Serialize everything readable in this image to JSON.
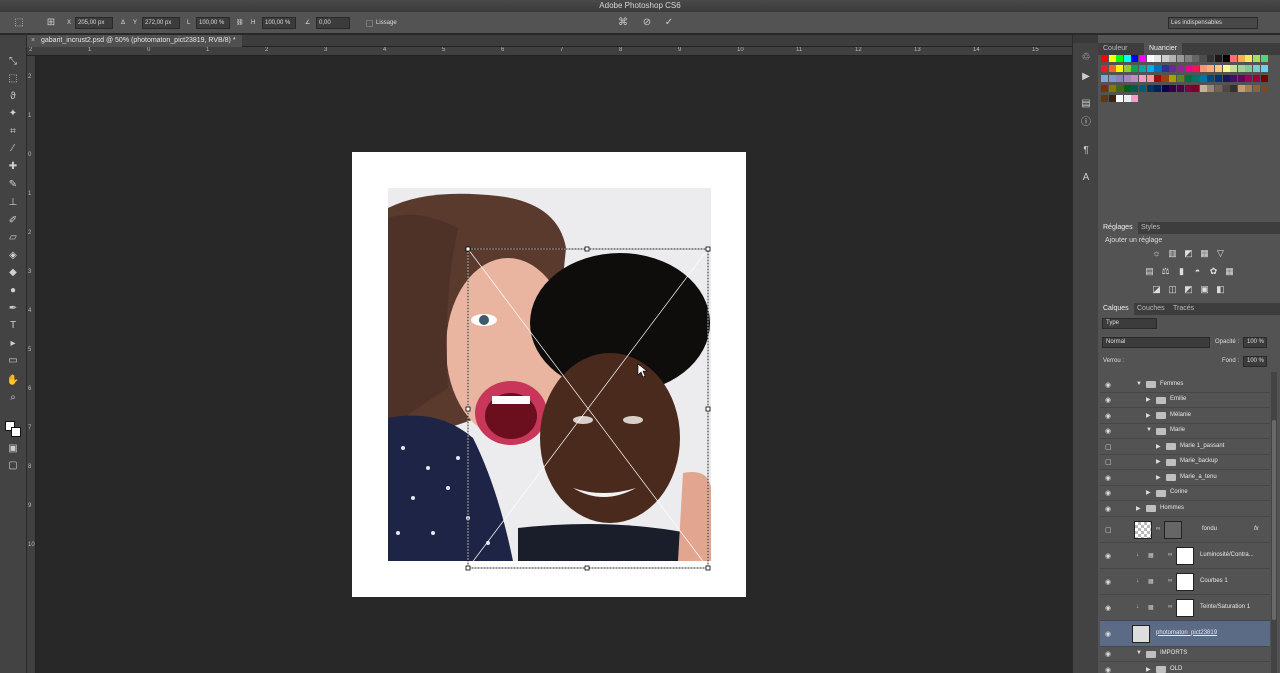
{
  "app": {
    "title": "Adobe Photoshop CS6"
  },
  "options": {
    "x_label": "X",
    "x_value": "205,00 px",
    "y_label": "Y",
    "y_value": "272,00 px",
    "w_label": "L",
    "w_value": "100,00 %",
    "h_label": "H",
    "h_value": "100,00 %",
    "angle_value": "0,00",
    "smoothing_label": "Lissage",
    "workspace": "Les indispensables"
  },
  "document": {
    "tab_title": "gabarit_incrust2.psd @ 50% (photomaton_pict23819, RVB/8) *"
  },
  "ruler": {
    "h_labels": [
      "2",
      "1",
      "0",
      "1",
      "2",
      "3",
      "4",
      "5",
      "6",
      "7",
      "8",
      "9",
      "10",
      "11",
      "12",
      "13",
      "14",
      "15",
      "16",
      "17"
    ],
    "v_labels": [
      "2",
      "1",
      "0",
      "1",
      "2",
      "3",
      "4",
      "5",
      "6",
      "7",
      "8",
      "9",
      "10"
    ]
  },
  "panels": {
    "color_tabs": [
      "Couleur",
      "Nuancier"
    ],
    "adjust_tabs": [
      "Réglages",
      "Styles"
    ],
    "adjust_label": "Ajouter un réglage",
    "layer_tabs": [
      "Calques",
      "Couches",
      "Tracés"
    ],
    "filter_type": "Type",
    "blend_mode": "Normal",
    "opacity_label": "Opacité :",
    "opacity_value": "100 %",
    "lock_label": "Verrou :",
    "fill_label": "Fond :",
    "fill_value": "100 %"
  },
  "layers": [
    {
      "name": "Femmes",
      "kind": "group",
      "indent": 0,
      "expanded": true,
      "visible": true
    },
    {
      "name": "Emilie",
      "kind": "group",
      "indent": 1,
      "expanded": false,
      "visible": true
    },
    {
      "name": "Mélanie",
      "kind": "group",
      "indent": 1,
      "expanded": false,
      "visible": true
    },
    {
      "name": "Marie",
      "kind": "group",
      "indent": 1,
      "expanded": true,
      "visible": true
    },
    {
      "name": "Marie 1_passant",
      "kind": "group",
      "indent": 2,
      "expanded": false,
      "visible": false
    },
    {
      "name": "Marie_backup",
      "kind": "group",
      "indent": 2,
      "expanded": false,
      "visible": false
    },
    {
      "name": "Marie_a_tenu",
      "kind": "group",
      "indent": 2,
      "expanded": false,
      "visible": true
    },
    {
      "name": "Corine",
      "kind": "group",
      "indent": 1,
      "expanded": false,
      "visible": true
    },
    {
      "name": "Hommes",
      "kind": "group",
      "indent": 0,
      "expanded": false,
      "visible": true
    },
    {
      "name": "fondu",
      "kind": "layer",
      "indent": 0,
      "visible": false,
      "fx": "fx"
    },
    {
      "name": "Luminosité/Contra...",
      "kind": "adjustment",
      "indent": 0,
      "visible": true
    },
    {
      "name": "Courbes 1",
      "kind": "adjustment",
      "indent": 0,
      "visible": true
    },
    {
      "name": "Teinte/Saturation 1",
      "kind": "adjustment",
      "indent": 0,
      "visible": true
    },
    {
      "name": "photomaton_pict23819",
      "kind": "photo",
      "indent": 0,
      "visible": true,
      "selected": true
    },
    {
      "name": "IMPORTS",
      "kind": "group",
      "indent": 0,
      "expanded": true,
      "visible": true
    },
    {
      "name": "OLD",
      "kind": "group",
      "indent": 1,
      "expanded": false,
      "visible": true
    }
  ],
  "colors": {
    "swatch_row1": [
      "#ff0000",
      "#ffff00",
      "#00ff00",
      "#00ffff",
      "#0000ff",
      "#ff00ff",
      "#ffffff",
      "#e6e6e6",
      "#cccccc",
      "#b3b3b3",
      "#999999",
      "#808080",
      "#666666",
      "#4d4d4d",
      "#333333",
      "#1a1a1a",
      "#000000",
      "#ff6e6e",
      "#f7ad4f",
      "#f9e55b",
      "#a6e05a",
      "#54d17d"
    ],
    "swatch_row2": [
      "#ed1c24",
      "#f26522",
      "#fff200",
      "#8dc63f",
      "#00a651",
      "#00a99d",
      "#00aeef",
      "#0072bc",
      "#2e3192",
      "#662d91",
      "#92278f",
      "#ec008c",
      "#ed145b",
      "#f7977a",
      "#fbad82",
      "#fdc68a",
      "#fff799",
      "#c4df9b",
      "#a3d39c",
      "#82ca9d",
      "#7bcdc8",
      "#6ecff6"
    ],
    "swatch_row3": [
      "#7ea7d8",
      "#8493ca",
      "#8882be",
      "#a187be",
      "#bc8dbf",
      "#f49ac2",
      "#f6989d",
      "#9e0b0f",
      "#a0410d",
      "#aba000",
      "#598527",
      "#007236",
      "#00746b",
      "#0076a3",
      "#004a80",
      "#003471",
      "#1b1464",
      "#440e62",
      "#630460",
      "#9e005d",
      "#9e0039",
      "#790000"
    ],
    "swatch_row4": [
      "#7b2e00",
      "#827b00",
      "#406618",
      "#005e20",
      "#005952",
      "#005b7f",
      "#003663",
      "#002157",
      "#0d004c",
      "#32004b",
      "#4b0049",
      "#7b0046",
      "#7a0026",
      "#c7b299",
      "#998675",
      "#736357",
      "#534741",
      "#37302d",
      "#c69c6d",
      "#a67c52",
      "#8c6239",
      "#754c24"
    ],
    "swatch_row5": [
      "#603913",
      "#3c2415",
      "#ffffff",
      "#eeeeee",
      "#ff99cc"
    ]
  }
}
